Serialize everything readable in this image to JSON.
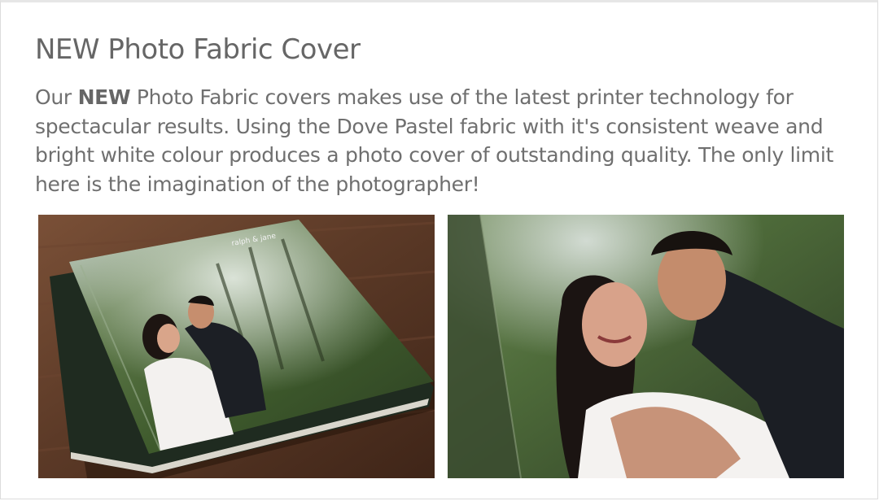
{
  "section": {
    "title": "NEW Photo Fabric Cover",
    "description": {
      "prefix": "Our ",
      "emphasis": "NEW",
      "rest": " Photo Fabric covers makes use of the latest printer technology for spectacular results. Using the Dove Pastel fabric with it's consistent weave and bright white colour produces a photo cover of outstanding quality. The only limit here is the imagination of the photographer!"
    }
  },
  "photos": [
    {
      "name": "album-on-table-photo",
      "cover_text": "ralph & jane"
    },
    {
      "name": "album-cover-closeup-photo"
    }
  ],
  "colors": {
    "text": "#6f6f6f",
    "border": "#dcdcdc",
    "wood": "#5a3a28"
  }
}
